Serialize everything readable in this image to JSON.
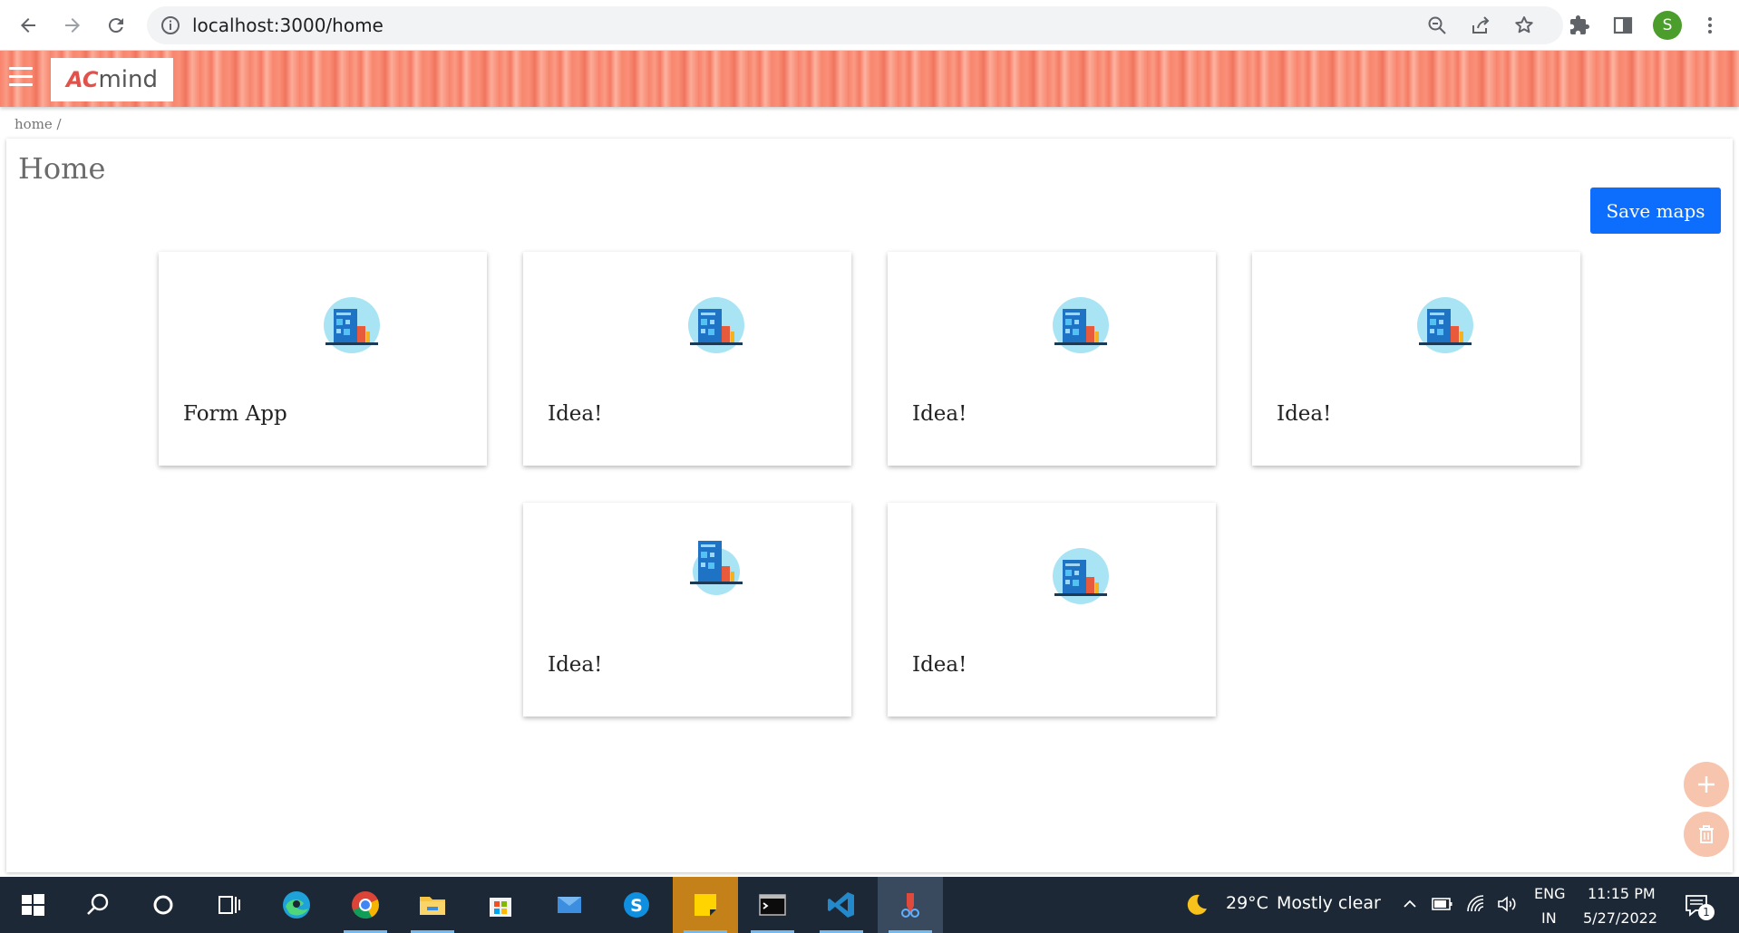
{
  "browser": {
    "url": "localhost:3000/home",
    "profile_initial": "S"
  },
  "app": {
    "logo_mark": "AC",
    "logo_text": "mind"
  },
  "breadcrumb": {
    "text": "home /"
  },
  "page": {
    "title": "Home",
    "save_label": "Save maps"
  },
  "cards": [
    {
      "title": "Form App",
      "icon": "building-icon"
    },
    {
      "title": "Idea!",
      "icon": "building-icon"
    },
    {
      "title": "Idea!",
      "icon": "building-icon"
    },
    {
      "title": "Idea!",
      "icon": "building-icon"
    },
    {
      "title": "Idea!",
      "icon": "building-icon"
    },
    {
      "title": "Idea!",
      "icon": "building-icon"
    }
  ],
  "fabs": {
    "add_icon": "plus-icon",
    "delete_icon": "trash-icon"
  },
  "taskbar": {
    "weather_temp": "29°C",
    "weather_text": "Mostly clear",
    "language": "ENG",
    "region": "IN",
    "time": "11:15 PM",
    "date": "5/27/2022",
    "notification_count": "1"
  },
  "colors": {
    "header_accent": "#f8826b",
    "save_button": "#0d6efd",
    "fab": "#f7c4ad",
    "taskbar": "#1c2836"
  }
}
